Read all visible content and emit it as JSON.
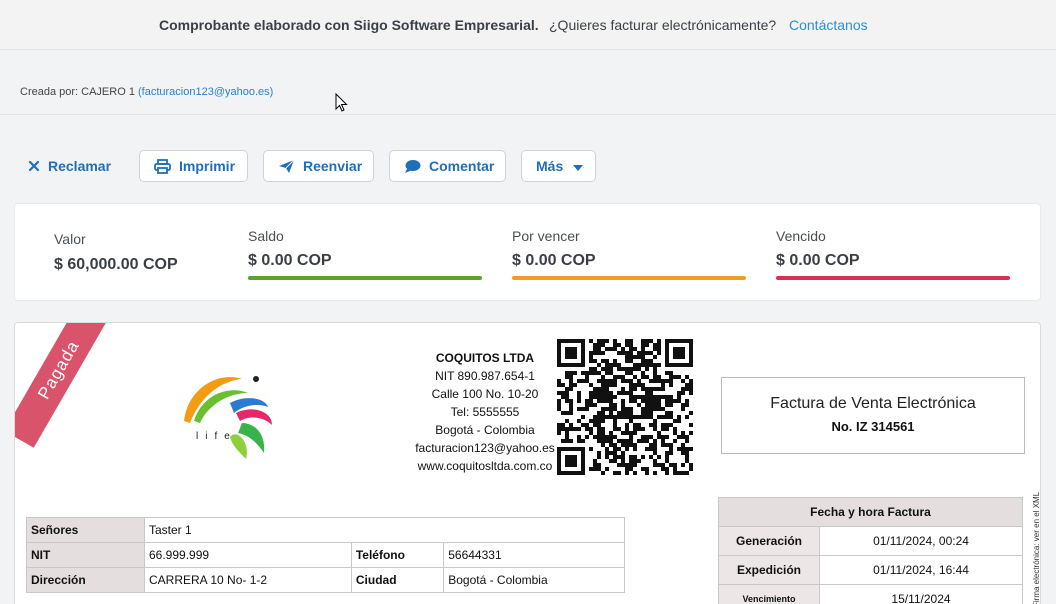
{
  "topbar": {
    "brand": "Comprobante elaborado con Siigo Software Empresarial.",
    "question": "¿Quieres facturar electrónicamente?",
    "contact": "Contáctanos"
  },
  "created": {
    "label": "Creada por: CAJERO 1",
    "email": "(facturacion123@yahoo.es)"
  },
  "actions": {
    "claim": "Reclamar",
    "print": "Imprimir",
    "resend": "Reenviar",
    "comment": "Comentar",
    "more": "Más"
  },
  "summary": {
    "value_label": "Valor",
    "value": "$ 60,000.00 COP",
    "balance_label": "Saldo",
    "balance": "$ 0.00 COP",
    "due_label": "Por vencer",
    "due": "$ 0.00 COP",
    "overdue_label": "Vencido",
    "overdue": "$ 0.00 COP",
    "colors": {
      "balance": "#5aa12f",
      "due": "#f39a2b",
      "overdue": "#d9304f"
    }
  },
  "invoice": {
    "status": "Pagada",
    "logo_text": "life",
    "company": {
      "name": "COQUITOS LTDA",
      "nit": "NIT 890.987.654-1",
      "address": "Calle 100 No. 10-20",
      "phone": "Tel: 5555555",
      "city": "Bogotá - Colombia",
      "email": "facturacion123@yahoo.es",
      "web": "www.coquitosltda.com.co"
    },
    "doc_type": "Factura de Venta Electrónica",
    "doc_number": "No. IZ 314561",
    "side_note": "Firma electrónica: ver en el XML",
    "client": {
      "senores_label": "Señores",
      "senores": "Taster 1",
      "nit_label": "NIT",
      "nit": "66.999.999",
      "phone_label": "Teléfono",
      "phone": "56644331",
      "address_label": "Dirección",
      "address": "CARRERA 10 No- 1-2",
      "city_label": "Ciudad",
      "city": "Bogotá - Colombia"
    },
    "dates": {
      "header": "Fecha y hora Factura",
      "generation_label": "Generación",
      "generation": "01/11/2024, 00:24",
      "expedition_label": "Expedición",
      "expedition": "01/11/2024, 16:44",
      "due_label": "Vencimiento",
      "due": "15/11/2024"
    }
  }
}
